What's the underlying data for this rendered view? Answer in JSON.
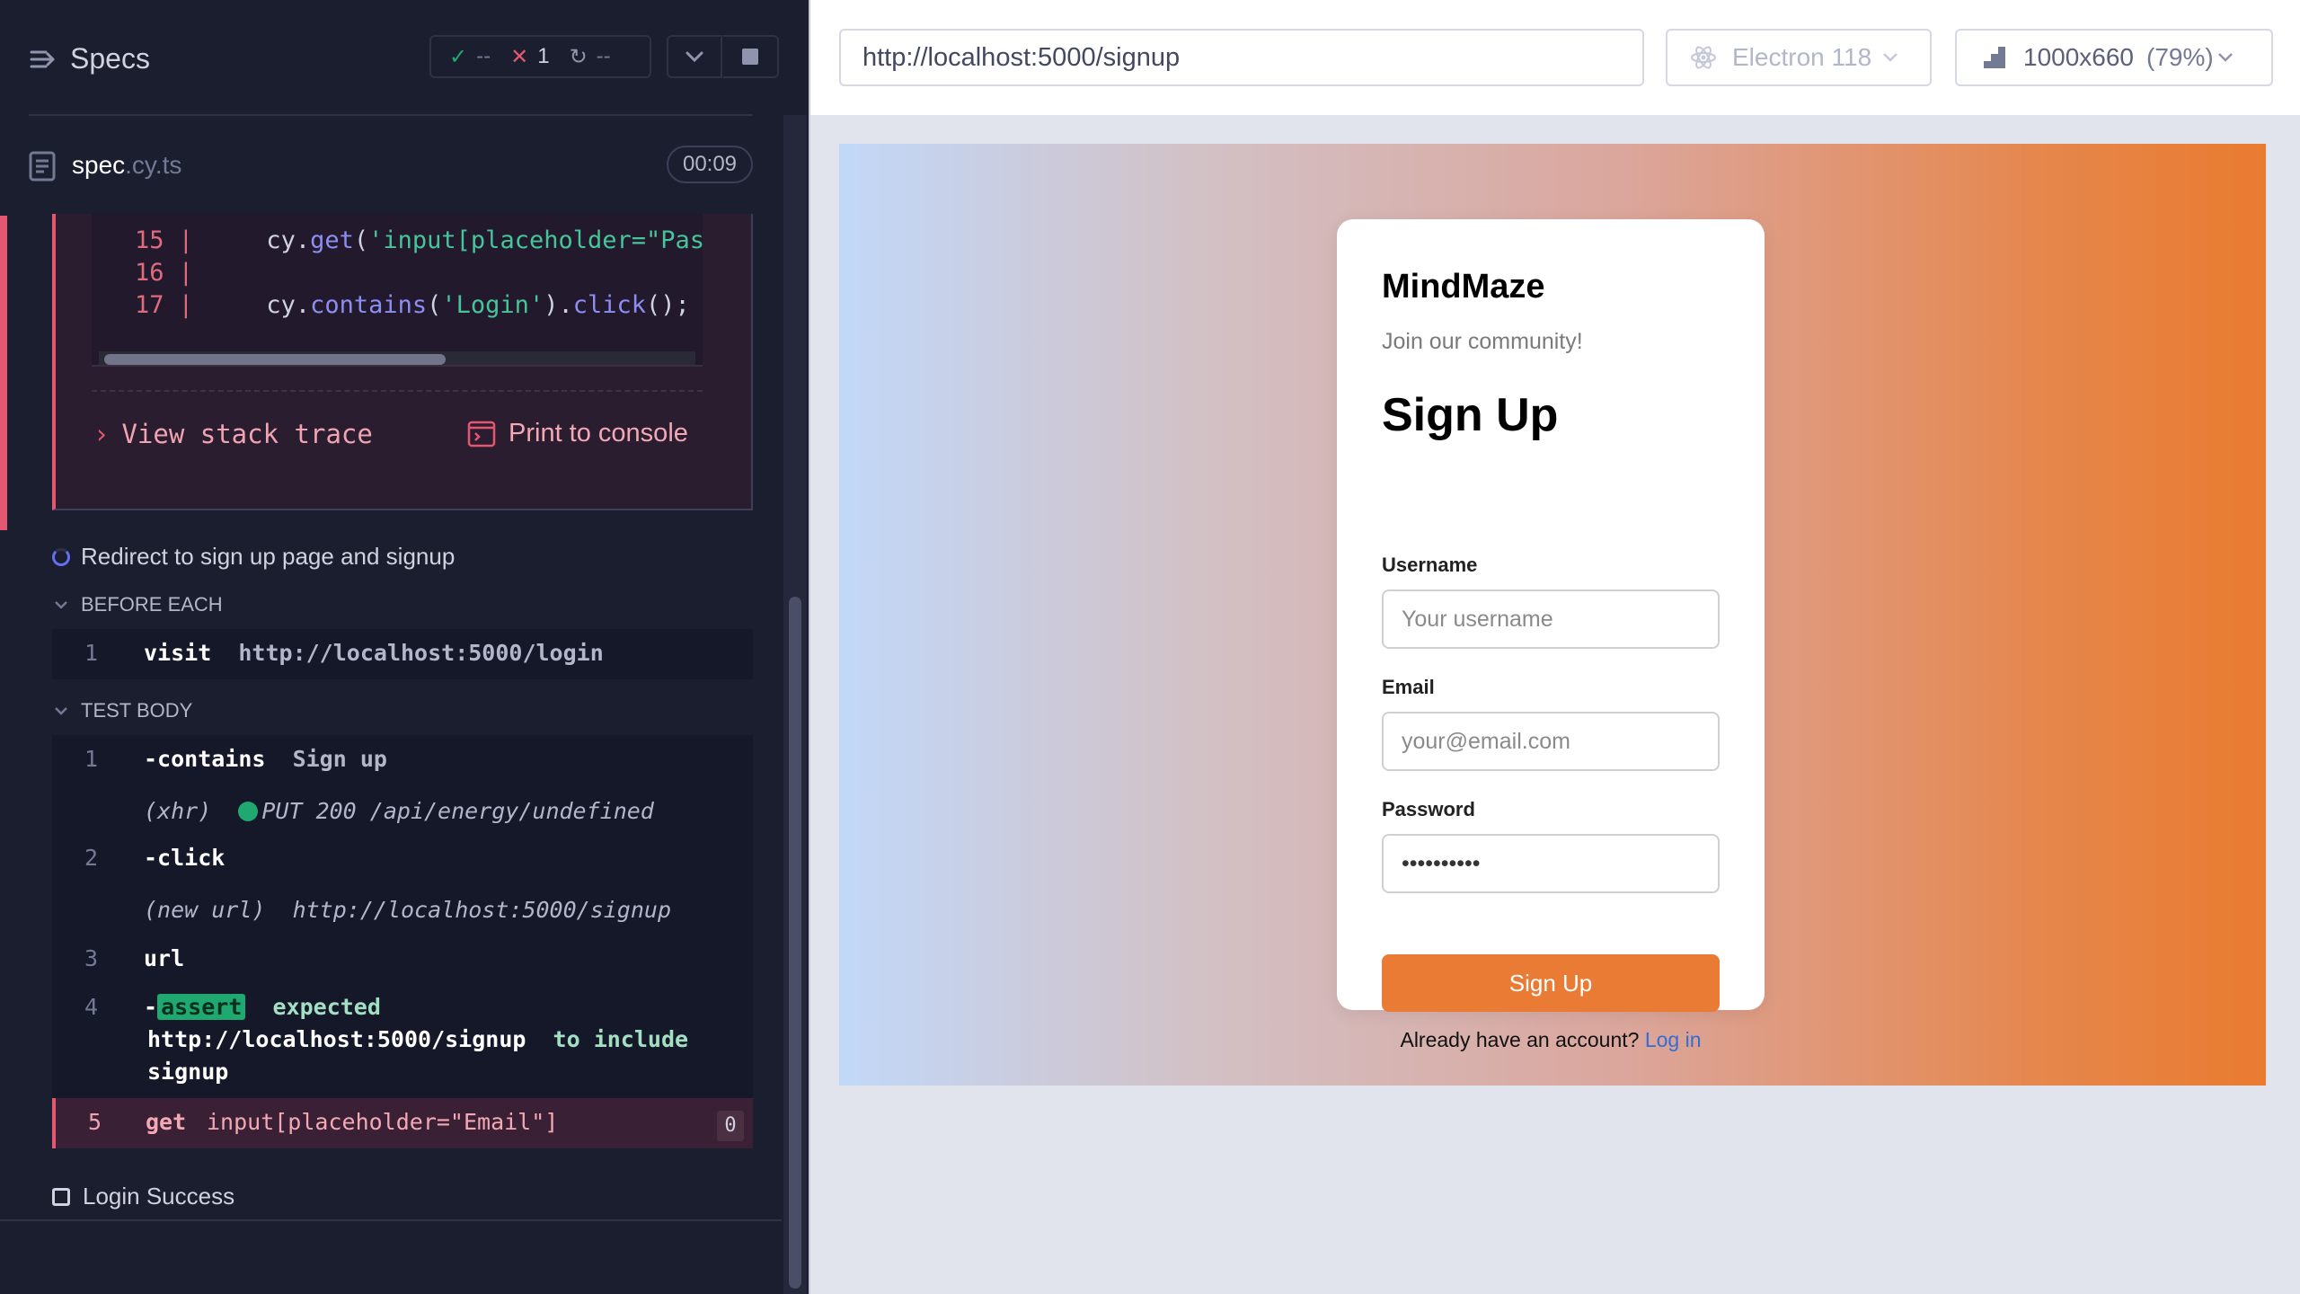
{
  "reporter": {
    "title": "Specs",
    "stats": {
      "passed": "--",
      "failed": "1",
      "pending": "--"
    },
    "spec": {
      "name": "spec",
      "ext": ".cy.ts",
      "timer": "00:09"
    },
    "error": {
      "code_lines": [
        {
          "num": "15",
          "text": "    cy.get('input[placeholder=\"Pass"
        },
        {
          "num": "16",
          "text": ""
        },
        {
          "num": "17",
          "text": "    cy.contains('Login').click();"
        }
      ],
      "view_stack_trace": "View stack trace",
      "print_to_console": "Print to console"
    },
    "test_title": "Redirect to sign up page and signup",
    "before_each_label": "BEFORE EACH",
    "before_each": [
      {
        "num": "1",
        "name": "visit",
        "message": "http://localhost:5000/login"
      }
    ],
    "test_body_label": "TEST BODY",
    "body": {
      "cmd1": {
        "num": "1",
        "name": "-contains",
        "message": "Sign up"
      },
      "xhr": {
        "prefix": "(xhr)",
        "message": "PUT 200 /api/energy/undefined"
      },
      "cmd2": {
        "num": "2",
        "name": "-click"
      },
      "newurl": {
        "prefix": "(new url)",
        "message": "http://localhost:5000/signup"
      },
      "cmd3": {
        "num": "3",
        "name": "url"
      },
      "cmd4": {
        "num": "4",
        "dash": "-",
        "tag": "assert",
        "expected": "expected",
        "url": "http://localhost:5000/signup",
        "to_include": "to include",
        "value": "signup"
      },
      "cmd5": {
        "num": "5",
        "name": "get",
        "message": "input[placeholder=\"Email\"]",
        "count": "0"
      }
    },
    "next_test": "Login Success"
  },
  "browser": {
    "url": "http://localhost:5000/signup",
    "browser_name": "Electron 118",
    "viewport": "1000x660",
    "zoom": "(79%)"
  },
  "app": {
    "brand": "MindMaze",
    "tagline": "Join our community!",
    "heading": "Sign Up",
    "username_label": "Username",
    "username_placeholder": "Your username",
    "email_label": "Email",
    "email_placeholder": "your@email.com",
    "password_label": "Password",
    "password_value": "••••••••••",
    "submit": "Sign Up",
    "login_prompt": "Already have an account?",
    "login_link": "Log in"
  },
  "colors": {
    "reporter_bg": "#1b1e2e",
    "fail": "#e45770",
    "pass": "#1fa971",
    "accent": "#e97b35",
    "link": "#2f6ed8"
  },
  "icons": [
    "specs-icon",
    "check-icon",
    "x-icon",
    "pending-icon",
    "chevron-down-icon",
    "stop-icon",
    "file-icon",
    "chevron-right-icon",
    "console-icon",
    "spinner-icon",
    "checkbox-icon",
    "electron-icon",
    "viewport-icon"
  ]
}
